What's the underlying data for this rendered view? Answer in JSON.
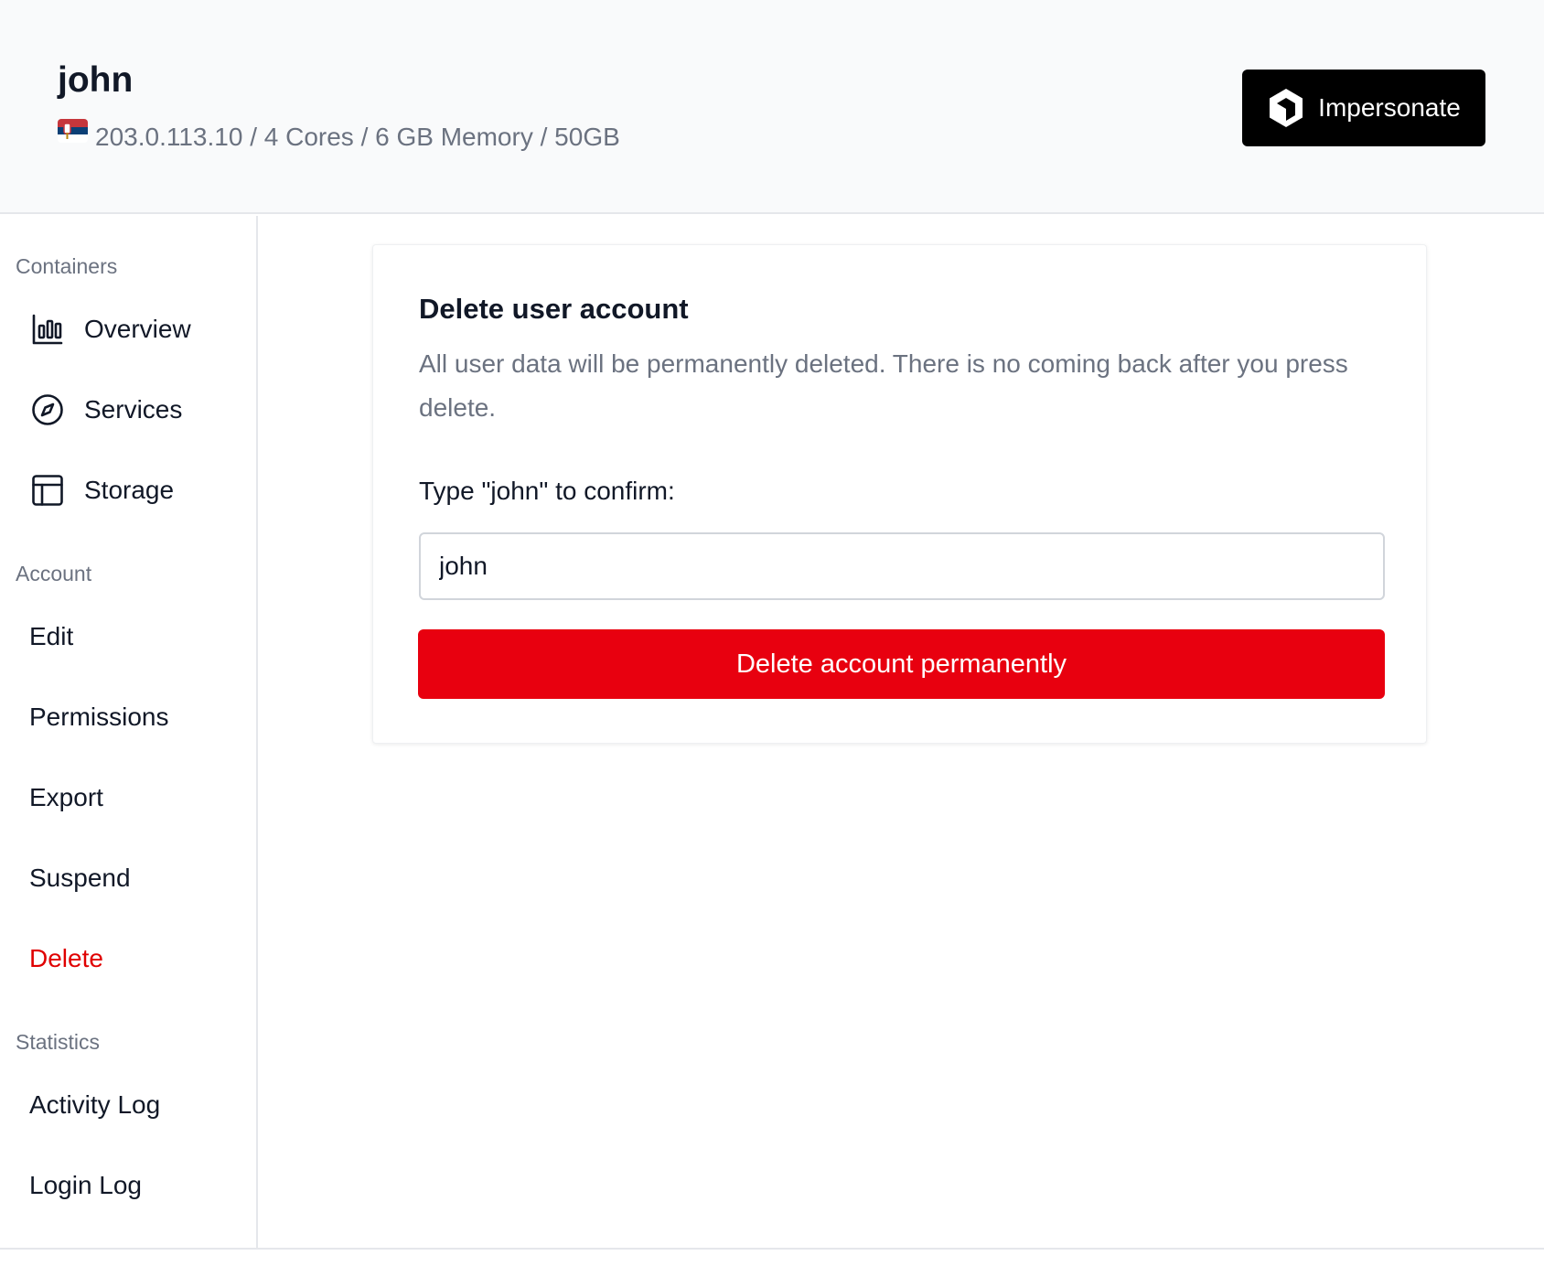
{
  "header": {
    "user_name": "john",
    "flag_icon": "serbia-flag-icon",
    "server_info": "203.0.113.10 / 4 Cores / 6 GB Memory / 50GB",
    "impersonate_label": "Impersonate",
    "impersonate_icon": "cube-icon"
  },
  "sidebar": {
    "sections": [
      {
        "title": "Containers",
        "items": [
          {
            "label": "Overview",
            "icon": "bar-chart-icon"
          },
          {
            "label": "Services",
            "icon": "compass-icon"
          },
          {
            "label": "Storage",
            "icon": "table-icon"
          }
        ]
      },
      {
        "title": "Account",
        "items": [
          {
            "label": "Edit"
          },
          {
            "label": "Permissions"
          },
          {
            "label": "Export"
          },
          {
            "label": "Suspend"
          },
          {
            "label": "Delete",
            "active": true
          }
        ]
      },
      {
        "title": "Statistics",
        "items": [
          {
            "label": "Activity Log"
          },
          {
            "label": "Login Log"
          }
        ]
      }
    ]
  },
  "card": {
    "title": "Delete user account",
    "description": "All user data will be permanently deleted. There is no coming back after you press delete.",
    "confirm_label": "Type \"john\" to confirm:",
    "confirm_value": "john",
    "delete_button_label": "Delete account permanently"
  },
  "colors": {
    "danger": "#e8000f",
    "danger_text": "#e00000",
    "muted_text": "#6b7280",
    "header_bg": "#f9fafb",
    "primary_button": "#000000"
  }
}
